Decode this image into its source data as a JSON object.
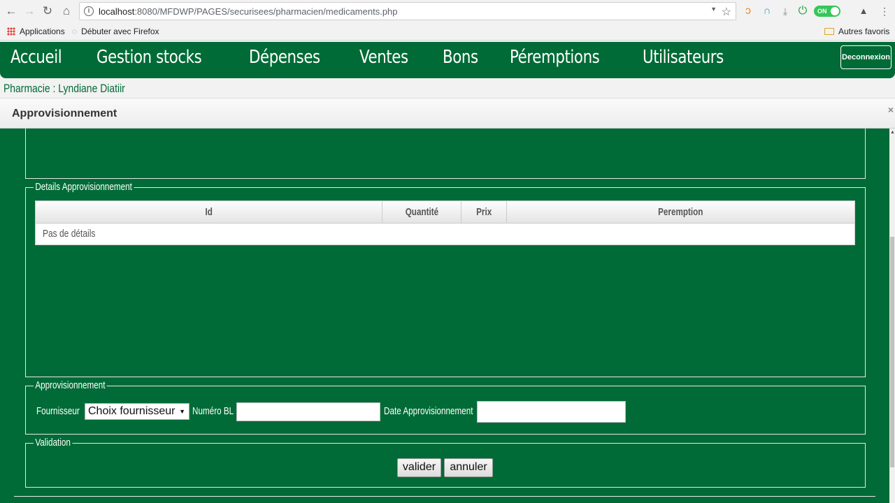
{
  "browser": {
    "url_host": "localhost",
    "url_rest": ":8080/MFDWP/PAGES/securisees/pharmacien/medicaments.php",
    "bookmarks": [
      "Applications",
      "Débuter avec Firefox"
    ],
    "other_bookmarks": "Autres favoris",
    "toggle_label": "ON"
  },
  "nav": {
    "items": [
      "Accueil",
      "Gestion stocks",
      "Dépenses",
      "Ventes",
      "Bons",
      "Péremptions",
      "Utilisateurs"
    ],
    "logout_label": "Deconnexion"
  },
  "pharmacy_label": "Pharmacie :  Lyndiane Diatiir",
  "modal": {
    "title": "Approvisionnement",
    "close": "×"
  },
  "details": {
    "legend": "Details Approvisionnement",
    "columns": [
      "Id",
      "Quantité",
      "Prix",
      "Peremption"
    ],
    "empty_text": "Pas de détails"
  },
  "approvisionnement": {
    "legend": "Approvisionnement",
    "supplier_label": "Fournisseur",
    "supplier_value": "Choix fournisseur",
    "bl_label": "Numéro BL",
    "bl_value": "",
    "date_label": "Date Approvisionnement",
    "date_value": ""
  },
  "validation": {
    "legend": "Validation",
    "submit_label": "valider",
    "cancel_label": "annuler"
  }
}
